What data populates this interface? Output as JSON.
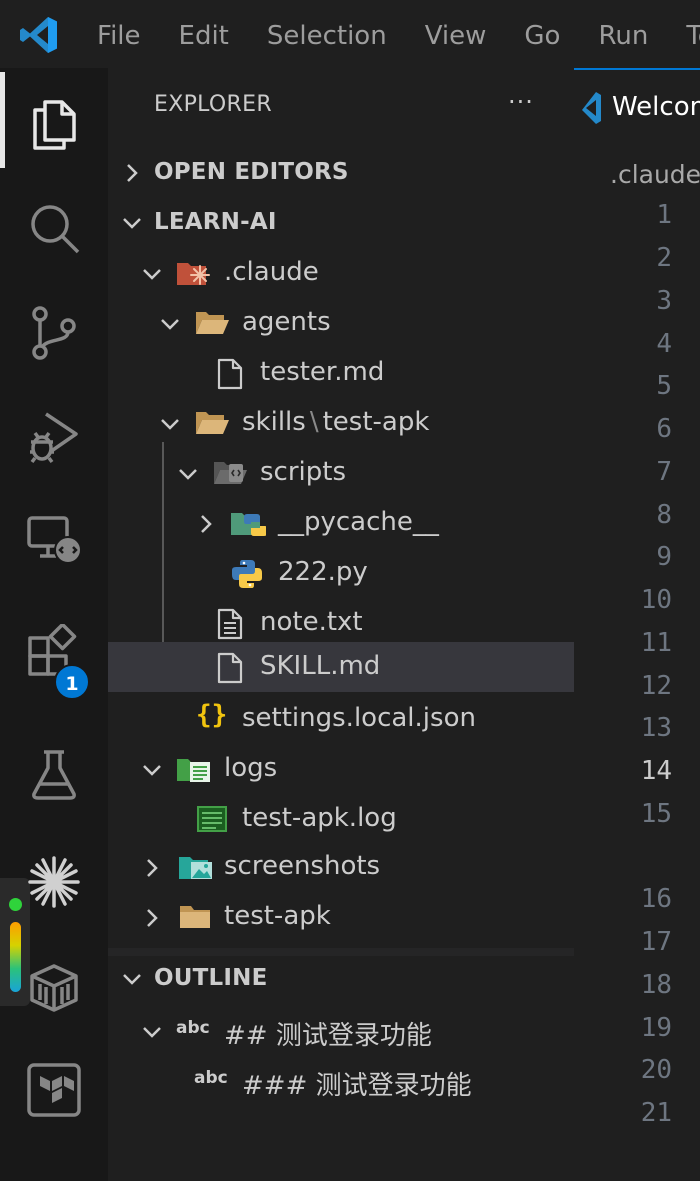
{
  "menu": [
    "File",
    "Edit",
    "Selection",
    "View",
    "Go",
    "Run",
    "Te"
  ],
  "activity_badge": "1",
  "sidebar": {
    "title": "EXPLORER",
    "more": "···",
    "open_editors": "OPEN EDITORS",
    "workspace": "LEARN-AI",
    "outline": "OUTLINE"
  },
  "tree": [
    {
      "label": ".claude",
      "icon": "claude-folder-icon"
    },
    {
      "label": "agents",
      "icon": "folder-open-icon"
    },
    {
      "label": "tester.md",
      "icon": "file-icon"
    },
    {
      "label": "skills",
      "label2": "test-apk",
      "sep": "\\",
      "icon": "folder-open-icon"
    },
    {
      "label": "scripts",
      "icon": "scripts-folder-icon"
    },
    {
      "label": "__pycache__",
      "icon": "python-folder-icon"
    },
    {
      "label": "222.py",
      "icon": "python-icon"
    },
    {
      "label": "note.txt",
      "icon": "text-file-icon"
    },
    {
      "label": "SKILL.md",
      "icon": "file-icon"
    },
    {
      "label": "settings.local.json",
      "icon": "json-icon"
    },
    {
      "label": "logs",
      "icon": "logs-folder-icon"
    },
    {
      "label": "test-apk.log",
      "icon": "log-file-icon"
    },
    {
      "label": "screenshots",
      "icon": "images-folder-icon"
    },
    {
      "label": "test-apk",
      "icon": "folder-icon"
    }
  ],
  "outline": [
    {
      "kind": "abc",
      "label": "## 测试登录功能"
    },
    {
      "kind": "abc",
      "label": "### 测试登录功能"
    }
  ],
  "editor": {
    "tab_title": "Welcome",
    "breadcrumb": ".claude",
    "line_numbers": [
      "1",
      "2",
      "3",
      "4",
      "5",
      "6",
      "7",
      "8",
      "9",
      "10",
      "11",
      "12",
      "13",
      "14",
      "15",
      "16",
      "17",
      "18",
      "19",
      "20",
      "21"
    ],
    "current_line": "14"
  },
  "colors": {
    "accent": "#0078d4",
    "selection": "#37373d",
    "folder": "#dcb67a"
  }
}
